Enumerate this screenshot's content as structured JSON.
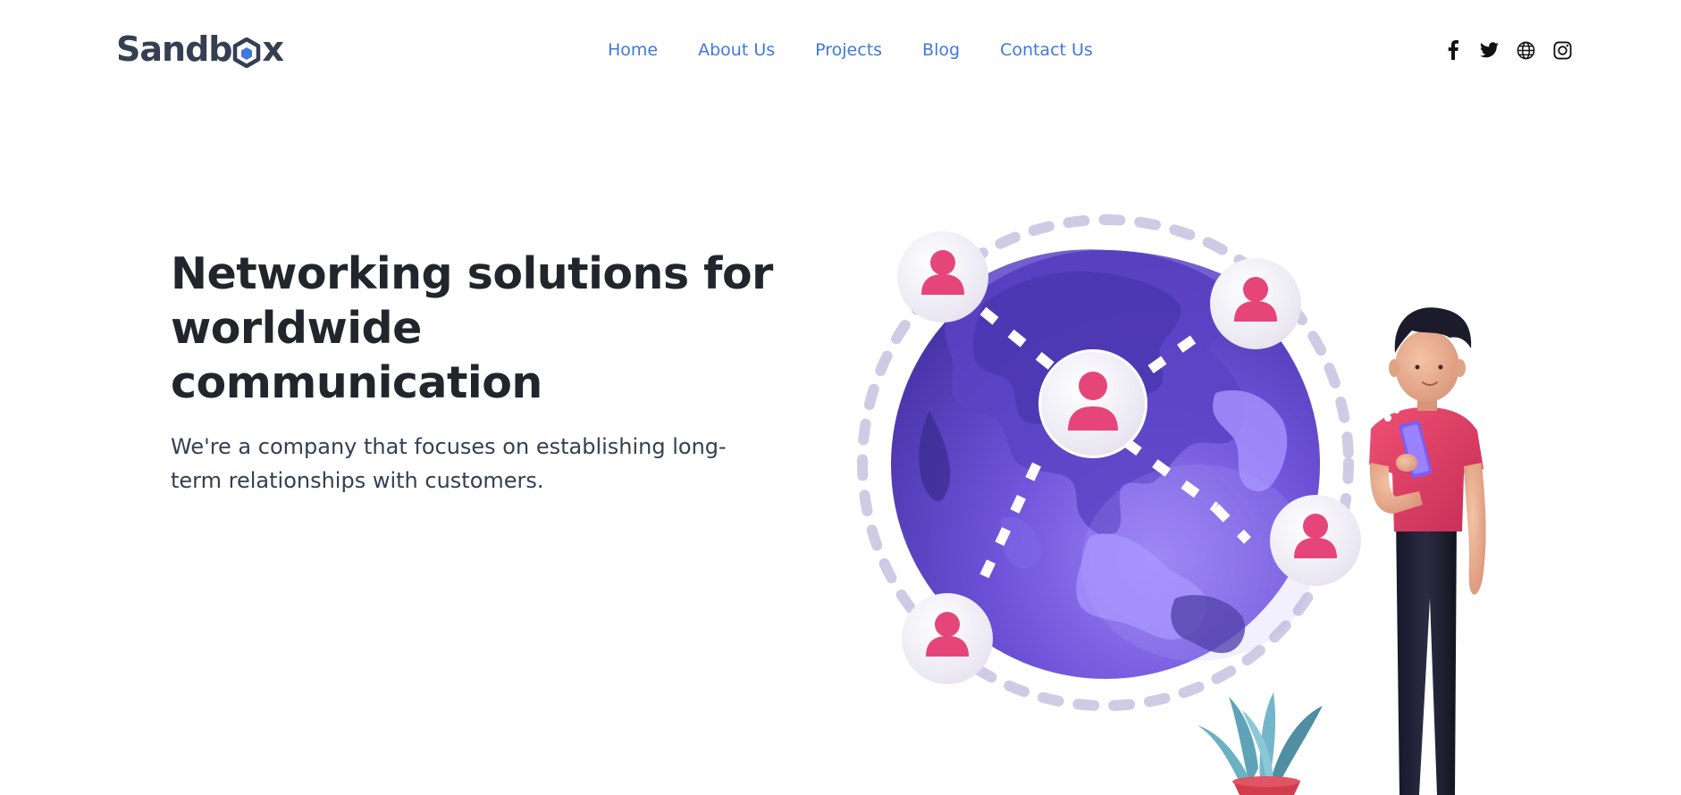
{
  "brand": {
    "logo_text_before": "Sandb",
    "logo_text_after": "x"
  },
  "nav": {
    "items": [
      {
        "label": "Home"
      },
      {
        "label": "About Us"
      },
      {
        "label": "Projects"
      },
      {
        "label": "Blog"
      },
      {
        "label": "Contact Us"
      }
    ]
  },
  "social": {
    "icons": [
      "facebook-icon",
      "twitter-icon",
      "globe-icon",
      "instagram-icon"
    ]
  },
  "hero": {
    "title_line1": "Networking solutions for",
    "title_line2": "worldwide communication",
    "subtitle": "We're a company that focuses on establishing long-term relationships with customers."
  },
  "colors": {
    "accent": "#3f78e0",
    "heading": "#21262c",
    "body": "#343f52",
    "globe": "#6f55d9",
    "user_pink": "#e6457a",
    "shirt": "#e23e63"
  }
}
